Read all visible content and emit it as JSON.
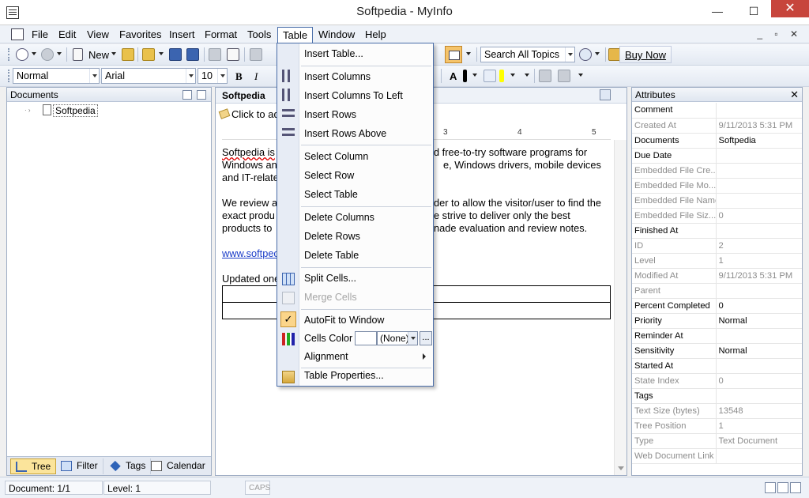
{
  "window": {
    "title": "Softpedia - MyInfo",
    "minimize_glyph": "—",
    "maximize_glyph": "☐",
    "close_glyph": "✕"
  },
  "menubar": {
    "items": [
      "File",
      "Edit",
      "View",
      "Favorites",
      "Insert",
      "Format",
      "Tools",
      "Table",
      "Window",
      "Help"
    ],
    "active": "Table",
    "mdi_controls": "_ ▫ ✕"
  },
  "toolbar1": {
    "new_label": "New",
    "search_value": "Search All Topics",
    "buy_now_label": "Buy Now"
  },
  "toolbar2": {
    "style_value": "Normal",
    "font_value": "Arial",
    "size_value": "10",
    "bold_label": "B",
    "italic_label": "I",
    "font_color_label": "A"
  },
  "documents_panel": {
    "title": "Documents",
    "tree": [
      {
        "label": "Softpedia"
      }
    ],
    "tabs": [
      {
        "label": "Tree",
        "active": true
      },
      {
        "label": "Filter",
        "active": false
      },
      {
        "label": "Tags",
        "active": false
      },
      {
        "label": "Calendar",
        "active": false
      }
    ]
  },
  "editor": {
    "doc_title": "Softpedia",
    "click_to_add": "Click to ad",
    "ruler": [
      "3",
      "4",
      "5"
    ],
    "para1_a": "Softpedia is",
    "para1_b": "d free-to-try software programs for",
    "para1_c": "Windows an",
    "para1_d": "e, Windows drivers, mobile devices",
    "para1_e": "and IT-relate",
    "para2_a": "We review a",
    "para2_b": "der to allow the visitor/user to find the",
    "para2_c": "exact produ",
    "para2_d": "e strive to deliver only the best",
    "para2_e": "products to",
    "para2_f": "nade evaluation and review notes.",
    "link": "www.softpec",
    "updated": "Updated one"
  },
  "table_menu": {
    "items": [
      {
        "label": "Insert Table...",
        "enabled": true
      },
      {
        "label": "Insert Columns",
        "enabled": true
      },
      {
        "label": "Insert Columns To Left",
        "enabled": true
      },
      {
        "label": "Insert Rows",
        "enabled": true
      },
      {
        "label": "Insert Rows Above",
        "enabled": true
      },
      {
        "label": "Select Column",
        "enabled": true
      },
      {
        "label": "Select Row",
        "enabled": true
      },
      {
        "label": "Select Table",
        "enabled": true
      },
      {
        "label": "Delete Columns",
        "enabled": true
      },
      {
        "label": "Delete Rows",
        "enabled": true
      },
      {
        "label": "Delete Table",
        "enabled": true
      },
      {
        "label": "Split Cells...",
        "enabled": true
      },
      {
        "label": "Merge Cells",
        "enabled": false
      },
      {
        "label": "AutoFit to Window",
        "enabled": true,
        "checked": true
      },
      {
        "label": "Cells Color",
        "enabled": true
      },
      {
        "label": "Alignment",
        "enabled": true,
        "submenu": true
      },
      {
        "label": "Table Properties...",
        "enabled": true
      }
    ],
    "cells_color_value": "(None)",
    "more_label": "...",
    "check_glyph": "✓"
  },
  "attributes_panel": {
    "title": "Attributes",
    "close_glyph": "✕",
    "rows": [
      {
        "key": "Comment",
        "value": "",
        "readonly": false
      },
      {
        "key": "Created At",
        "value": "9/11/2013 5:31 PM",
        "readonly": true
      },
      {
        "key": "Documents",
        "value": "Softpedia",
        "readonly": false
      },
      {
        "key": "Due Date",
        "value": "",
        "readonly": false
      },
      {
        "key": "Embedded File Cre...",
        "value": "",
        "readonly": true
      },
      {
        "key": "Embedded File Mo...",
        "value": "",
        "readonly": true
      },
      {
        "key": "Embedded File Name",
        "value": "",
        "readonly": true
      },
      {
        "key": "Embedded File Siz...",
        "value": "0",
        "readonly": true
      },
      {
        "key": "Finished At",
        "value": "",
        "readonly": false
      },
      {
        "key": "ID",
        "value": "2",
        "readonly": true
      },
      {
        "key": "Level",
        "value": "1",
        "readonly": true
      },
      {
        "key": "Modified At",
        "value": "9/11/2013 5:31 PM",
        "readonly": true
      },
      {
        "key": "Parent",
        "value": "",
        "readonly": true
      },
      {
        "key": "Percent Completed",
        "value": "0",
        "readonly": false
      },
      {
        "key": "Priority",
        "value": "Normal",
        "readonly": false
      },
      {
        "key": "Reminder At",
        "value": "",
        "readonly": false
      },
      {
        "key": "Sensitivity",
        "value": "Normal",
        "readonly": false
      },
      {
        "key": "Started At",
        "value": "",
        "readonly": false
      },
      {
        "key": "State Index",
        "value": "0",
        "readonly": true
      },
      {
        "key": "Tags",
        "value": "",
        "readonly": false
      },
      {
        "key": "Text Size (bytes)",
        "value": "13548",
        "readonly": true
      },
      {
        "key": "Tree Position",
        "value": "1",
        "readonly": true
      },
      {
        "key": "Type",
        "value": "Text Document",
        "readonly": true
      },
      {
        "key": "Web Document Link",
        "value": "",
        "readonly": true
      }
    ]
  },
  "statusbar": {
    "document": "Document: 1/1",
    "level": "Level: 1",
    "caps": "CAPS"
  },
  "colors": {
    "accent_blue": "#4a6ea9",
    "close_red": "#c7453c",
    "highlight_orange": "#fbd58a",
    "link_blue": "#1a3cc8"
  }
}
